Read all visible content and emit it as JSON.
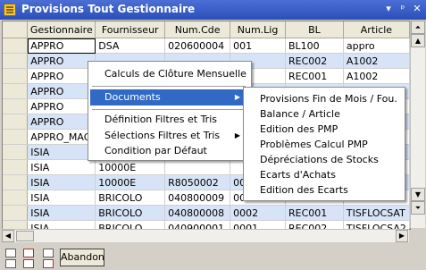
{
  "window": {
    "title": "Provisions Tout Gestionnaire",
    "menu_glyph": "▾",
    "pin_glyph": "ᵖ",
    "close_glyph": "✕"
  },
  "grid": {
    "columns": [
      "Gestionnaire",
      "Fournisseur",
      "Num.Cde",
      "Num.Lig",
      "BL",
      "Article"
    ],
    "rows": [
      [
        "APPRO",
        "DSA",
        "020600004",
        "001",
        "BL100",
        "appro"
      ],
      [
        "APPRO",
        "",
        "",
        "",
        "REC002",
        "A1002"
      ],
      [
        "APPRO",
        "",
        "",
        "",
        "REC001",
        "A1002"
      ],
      [
        "APPRO",
        "",
        "",
        "",
        "",
        ""
      ],
      [
        "APPRO",
        "",
        "",
        "",
        "",
        ""
      ],
      [
        "APPRO",
        "",
        "",
        "",
        "",
        ""
      ],
      [
        "APPRO_MAG",
        "",
        "",
        "",
        "",
        ""
      ],
      [
        "ISIA",
        "",
        "",
        "",
        "",
        ""
      ],
      [
        "ISIA",
        "10000E",
        "",
        "",
        "",
        ""
      ],
      [
        "ISIA",
        "10000E",
        "R8050002",
        "00",
        "",
        ""
      ],
      [
        "ISIA",
        "BRICOLO",
        "040800009",
        "00",
        "",
        ""
      ],
      [
        "ISIA",
        "BRICOLO",
        "040800008",
        "0002",
        "REC001",
        "TISFLOCSAT"
      ],
      [
        "ISIA",
        "BRICOLO",
        "040900001",
        "0001",
        "REC002",
        "TISFLOCSA2"
      ]
    ]
  },
  "context_menu": {
    "items": [
      "Calculs de Clôture Mensuelle",
      "Documents",
      "Définition Filtres et Tris",
      "Sélections Filtres et Tris",
      "Condition par Défaut"
    ],
    "highlighted": "Documents",
    "submenu_arrow": "▶"
  },
  "submenu": {
    "items": [
      "Provisions Fin de Mois / Fou.",
      "Balance / Article",
      "Edition des PMP",
      "Problèmes Calcul PMP",
      "Dépréciations de Stocks",
      "Ecarts d'Achats",
      "Edition des Ecarts"
    ]
  },
  "scrollbar": {
    "top": "⏶",
    "up": "▲",
    "down": "▼",
    "bottom": "⏷",
    "left": "◀",
    "right": "▶"
  },
  "toolbar": {
    "abandon_label": "Abandon"
  },
  "colors": {
    "title_bar": "#2b4fb8",
    "row_alt": "#d7e4f7",
    "menu_highlight": "#316ac5"
  }
}
